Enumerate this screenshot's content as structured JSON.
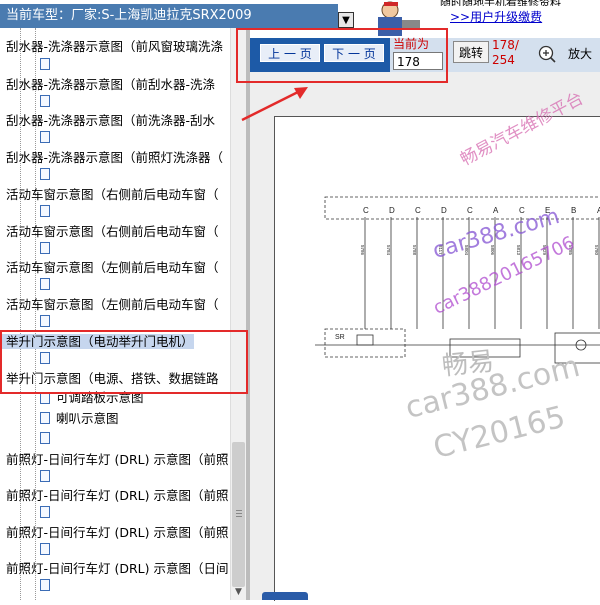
{
  "header": {
    "model_label": "当前车型：",
    "model_value": "厂家:S-上海凯迪拉克SRX2009",
    "dropdown_glyph": "▼",
    "notice_text": "随时随地手机看维修资料",
    "upgrade_link": ">>用户升级缴费"
  },
  "tree": {
    "items": [
      {
        "label": "刮水器-洗涤器示意图（前风窗玻璃洗涤",
        "selected": false
      },
      {
        "label": "刮水器-洗涤器示意图（前刮水器-洗涤",
        "selected": false
      },
      {
        "label": "刮水器-洗涤器示意图（前洗涤器-刮水",
        "selected": false
      },
      {
        "label": "刮水器-洗涤器示意图（前照灯洗涤器（",
        "selected": false
      },
      {
        "label": "活动车窗示意图（右侧前后电动车窗（",
        "selected": false
      },
      {
        "label": "活动车窗示意图（右侧前后电动车窗（",
        "selected": false
      },
      {
        "label": "活动车窗示意图（左侧前后电动车窗（",
        "selected": false
      },
      {
        "label": "活动车窗示意图（左侧前后电动车窗（",
        "selected": false
      },
      {
        "label": "举升门示意图（电动举升门电机）",
        "selected": true
      },
      {
        "label": "举升门示意图（电源、搭铁、数据链路",
        "selected": false
      }
    ],
    "sub_items": [
      "可调踏板示意图",
      "喇叭示意图"
    ],
    "items_after": [
      "前照灯-日间行车灯 (DRL) 示意图（前照",
      "前照灯-日间行车灯 (DRL) 示意图（前照",
      "前照灯-日间行车灯 (DRL) 示意图（前照",
      "前照灯-日间行车灯 (DRL) 示意图（日间"
    ]
  },
  "toolbar": {
    "prev_label": "上 一 页",
    "next_label": "下 一 页",
    "current_label": "当前为",
    "current_page": "178",
    "jump_label": "跳转",
    "page_count_current": "178/",
    "page_count_total": "254",
    "zoom_label": "放大"
  },
  "watermarks": {
    "platform": "畅易汽车维修平台",
    "site": "car388.com",
    "phone": "car38820165706",
    "brand": "畅易",
    "site_gray": "car388.com",
    "code": "CY20165"
  },
  "schematic": {
    "labels_top": [
      "C",
      "D",
      "C",
      "D",
      "C",
      "A",
      "C",
      "E",
      "B",
      "A"
    ],
    "wire_codes": [
      "5786",
      "5784",
      "5788",
      "8117",
      "5804",
      "5806",
      "5813",
      "5829",
      "5785",
      "5780"
    ],
    "component_label": "SR"
  },
  "colors": {
    "header_blue": "#4a7bb0",
    "pager_blue": "#1d5aa7",
    "selection": "#c6d6ee",
    "annotation_red": "#e32a2a",
    "page_count_red": "#cc0000"
  }
}
